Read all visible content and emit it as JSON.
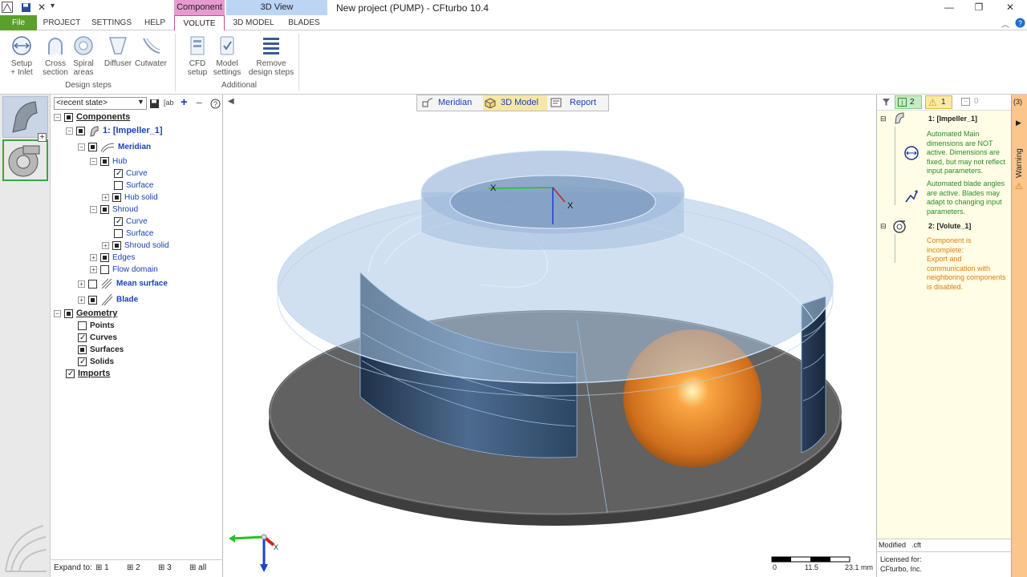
{
  "titlebar": {
    "title": "New project (PUMP) - CFturbo 10.4",
    "context_component": "Component",
    "context_3dview": "3D View"
  },
  "ribbon_tabs": [
    "File",
    "PROJECT",
    "SETTINGS",
    "HELP",
    "VOLUTE",
    "3D MODEL",
    "BLADES"
  ],
  "ribbon": {
    "design_steps": [
      {
        "label1": "Setup",
        "label2": "+ Inlet",
        "icon": "setup-inlet-icon"
      },
      {
        "label1": "Cross",
        "label2": "section",
        "icon": "cross-section-icon"
      },
      {
        "label1": "Spiral",
        "label2": "areas",
        "icon": "spiral-areas-icon"
      },
      {
        "label1": "Diffuser",
        "label2": "",
        "icon": "diffuser-icon"
      },
      {
        "label1": "Cutwater",
        "label2": "",
        "icon": "cutwater-icon"
      }
    ],
    "design_steps_label": "Design steps",
    "additional": [
      {
        "label1": "CFD",
        "label2": "setup",
        "icon": "cfd-setup-icon"
      },
      {
        "label1": "Model",
        "label2": "settings",
        "icon": "model-settings-icon"
      },
      {
        "label1": "Remove",
        "label2": "design steps",
        "icon": "remove-design-steps-icon"
      }
    ],
    "additional_label": "Additional"
  },
  "tree": {
    "state_select": "<recent state>",
    "nodes": {
      "components": "Components",
      "impeller": "1: [Impeller_1]",
      "meridian": "Meridian",
      "hub": "Hub",
      "hub_curve": "Curve",
      "hub_surface": "Surface",
      "hub_solid": "Hub solid",
      "shroud": "Shroud",
      "shroud_curve": "Curve",
      "shroud_surface": "Surface",
      "shroud_solid": "Shroud solid",
      "edges": "Edges",
      "flow_domain": "Flow domain",
      "mean_surface": "Mean surface",
      "blade": "Blade",
      "geometry": "Geometry",
      "points": "Points",
      "curves": "Curves",
      "surfaces": "Surfaces",
      "solids": "Solids",
      "imports": "Imports"
    },
    "expand_label": "Expand to:",
    "expand_levels": [
      "1",
      "2",
      "3",
      "all"
    ]
  },
  "viewport": {
    "tabs": [
      "Meridian",
      "3D Model",
      "Report"
    ],
    "active_tab": "3D Model",
    "scale": {
      "min": "0",
      "mid": "11.5",
      "max": "23.1 mm"
    },
    "axis_x": "X",
    "axis_z": "Z"
  },
  "messages": {
    "info_count": "2",
    "warn_count": "1",
    "other_count": "0",
    "impeller_title": "1: [Impeller_1]",
    "msg1": "Automated Main dimensions are NOT active. Dimensions are fixed, but may not reflect input parameters.",
    "msg2": "Automated blade angles are active. Blades may adapt to changing input parameters.",
    "volute_title": "2: [Volute_1]",
    "msg3": "Component is incomplete:",
    "msg4": "Export and communication with neighboring components is disabled.",
    "modified_label": "Modified",
    "modified_ext": ".cft",
    "licensed_label": "Licensed for:",
    "licensed_to": "CFturbo, Inc."
  },
  "warning_strip": {
    "count": "(3)",
    "label": "Warning"
  },
  "colors": {
    "file_tab": "#5aa02c",
    "context_component": "#e79ad0",
    "context_3dview": "#bcd5f4",
    "warning_strip": "#fbc58c"
  }
}
